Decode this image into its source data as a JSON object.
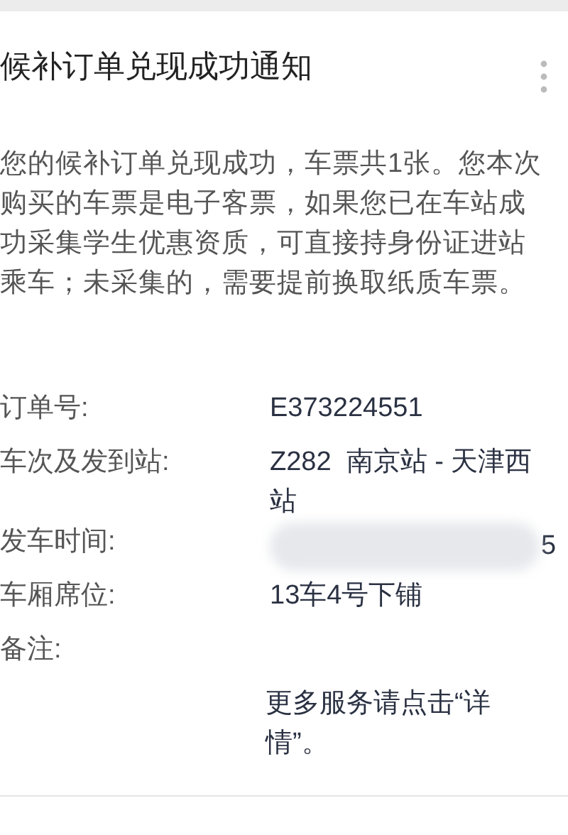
{
  "title": "候补订单兑现成功通知",
  "message": "您的候补订单兑现成功，车票共1张。您本次购买的车票是电子客票，如果您已在车站成功采集学生优惠资质，可直接持身份证进站乘车；未采集的，需要提前换取纸质车票。",
  "fields": [
    {
      "label": "订单号:",
      "value": "E373224551",
      "kind": "text"
    },
    {
      "label": "车次及发到站:",
      "value": "Z282  南京站 - 天津西站",
      "kind": "text"
    },
    {
      "label": "发车时间:",
      "value": "5",
      "kind": "redacted"
    },
    {
      "label": "车厢席位:",
      "value": "13车4号下铺",
      "kind": "text"
    },
    {
      "label": "备注:",
      "kind": "label"
    }
  ],
  "note": "更多服务请点击“详情”。"
}
